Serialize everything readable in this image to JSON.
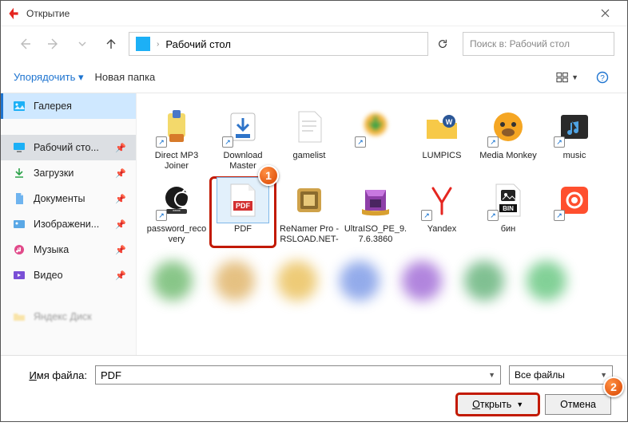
{
  "window": {
    "title": "Открытие"
  },
  "nav": {
    "location": "Рабочий стол",
    "search_placeholder": "Поиск в: Рабочий стол"
  },
  "toolbar": {
    "organize": "Упорядочить",
    "new_folder": "Новая папка"
  },
  "sidebar": {
    "gallery": "Галерея",
    "items": [
      {
        "label": "Рабочий сто...",
        "icon": "desktop",
        "pinned": true,
        "selected": true
      },
      {
        "label": "Загрузки",
        "icon": "downloads",
        "pinned": true
      },
      {
        "label": "Документы",
        "icon": "documents",
        "pinned": true
      },
      {
        "label": "Изображени...",
        "icon": "pictures",
        "pinned": true
      },
      {
        "label": "Музыка",
        "icon": "music",
        "pinned": true
      },
      {
        "label": "Видео",
        "icon": "videos",
        "pinned": true
      }
    ],
    "extra": "Яндекс Диск"
  },
  "files": {
    "row1": [
      {
        "label": "Direct MP3 Joiner",
        "icon": "mp3joiner",
        "shortcut": true
      },
      {
        "label": "Download Master",
        "icon": "dm",
        "shortcut": true
      },
      {
        "label": "gamelist",
        "icon": "txt"
      },
      {
        "label": "",
        "icon": "idm-blur",
        "shortcut": true
      },
      {
        "label": "LUMPICS",
        "icon": "folder-word"
      },
      {
        "label": "Media Monkey",
        "icon": "mediamonkey",
        "shortcut": true
      },
      {
        "label": "music",
        "icon": "music-folder",
        "shortcut": true
      }
    ],
    "row2": [
      {
        "label": "password_recovery",
        "icon": "passrec",
        "shortcut": true
      },
      {
        "label": "PDF",
        "icon": "pdf",
        "selected": true
      },
      {
        "label": "ReNamer Pro -RSLOAD.NET-",
        "icon": "renamer"
      },
      {
        "label": "UltraISO_PE_9.7.6.3860",
        "icon": "winrar"
      },
      {
        "label": "Yandex",
        "icon": "yandex",
        "shortcut": true
      },
      {
        "label": "бин",
        "icon": "bin",
        "shortcut": true
      },
      {
        "label": "",
        "icon": "rec",
        "shortcut": true
      }
    ]
  },
  "markers": {
    "one": "1",
    "two": "2"
  },
  "footer": {
    "filename_label": "Имя файла:",
    "filename_value": "PDF",
    "filter": "Все файлы",
    "open": "Открыть",
    "cancel": "Отмена"
  }
}
